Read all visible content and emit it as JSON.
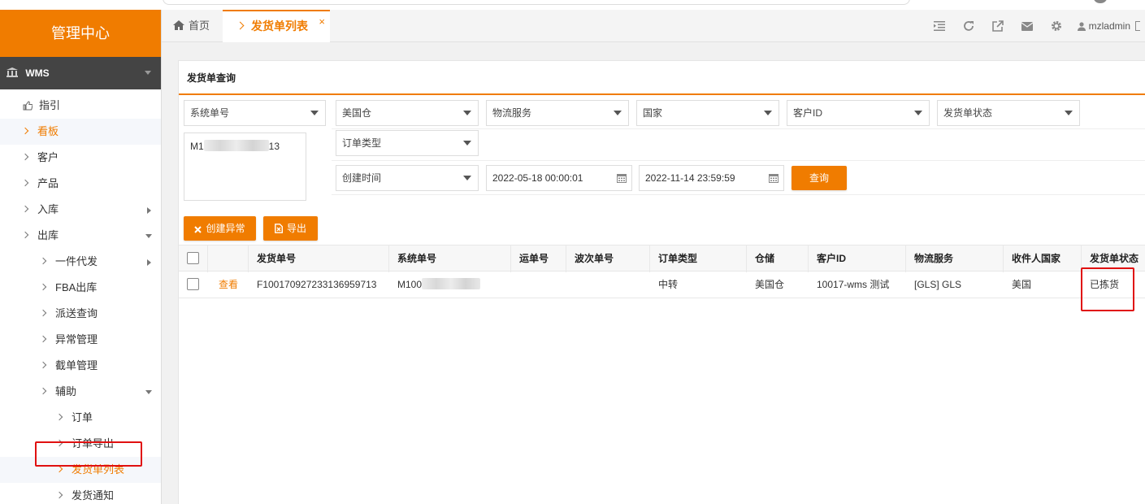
{
  "sidebar": {
    "brand": "管理中心",
    "module": "WMS",
    "items": [
      {
        "label": "指引"
      },
      {
        "label": "看板"
      },
      {
        "label": "客户"
      },
      {
        "label": "产品"
      },
      {
        "label": "入库"
      },
      {
        "label": "出库"
      },
      {
        "label": "一件代发"
      },
      {
        "label": "FBA出库"
      },
      {
        "label": "派送查询"
      },
      {
        "label": "异常管理"
      },
      {
        "label": "截单管理"
      },
      {
        "label": "辅助"
      },
      {
        "label": "订单"
      },
      {
        "label": "订单导出"
      },
      {
        "label": "发货单列表"
      },
      {
        "label": "发货通知"
      }
    ]
  },
  "tabs": {
    "home": "首页",
    "active": "发货单列表",
    "close": "×"
  },
  "user": {
    "name": "mzladmin"
  },
  "panel": {
    "title": "发货单查询"
  },
  "filters": {
    "system_no": "系统单号",
    "warehouse": "美国仓",
    "logistics": "物流服务",
    "country": "国家",
    "customer_id": "客户ID",
    "status": "发货单状态",
    "order_type": "订单类型",
    "time_type": "创建时间",
    "date_start": "2022-05-18 00:00:01",
    "date_end": "2022-11-14 23:59:59",
    "textarea_prefix": "M1",
    "textarea_suffix": "13",
    "query_button": "查询"
  },
  "actions": {
    "create_exception": "创建异常",
    "export": "导出"
  },
  "table": {
    "headers": [
      "发货单号",
      "系统单号",
      "运单号",
      "波次单号",
      "订单类型",
      "仓储",
      "客户ID",
      "物流服务",
      "收件人国家",
      "发货单状态"
    ],
    "rows": [
      {
        "view": "查看",
        "shipment_no": "F100170927233136959713",
        "system_no": "M100",
        "tracking_no": "",
        "wave_no": "",
        "order_type": "中转",
        "warehouse": "美国仓",
        "customer_id": "10017-wms 测试",
        "logistics": "[GLS] GLS",
        "country": "美国",
        "status": "已拣货"
      }
    ]
  },
  "colors": {
    "accent": "#f07c00",
    "highlight": "#e01010"
  }
}
